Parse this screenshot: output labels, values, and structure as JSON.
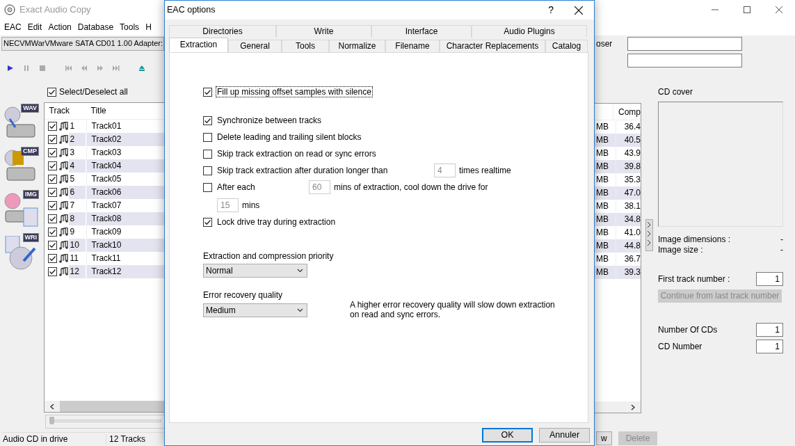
{
  "main_window": {
    "title": "Exact Audio Copy",
    "menu": [
      "EAC",
      "Edit",
      "Action",
      "Database",
      "Tools",
      "H"
    ],
    "drive": "NECVMWarVMware SATA CD01 1.00  Adapter:",
    "select_all": {
      "label": "Select/Deselect all",
      "checked": true
    },
    "actions": [
      {
        "label": "WAV",
        "kind": "wav"
      },
      {
        "label": "CMP",
        "kind": "cmp"
      },
      {
        "label": "IMG",
        "kind": "img"
      },
      {
        "label": "WRI",
        "kind": "wri"
      }
    ],
    "track_table": {
      "columns": [
        "Track",
        "Title"
      ],
      "rows": [
        {
          "checked": true,
          "number": "1",
          "title": "Track01"
        },
        {
          "checked": true,
          "number": "2",
          "title": "Track02"
        },
        {
          "checked": true,
          "number": "3",
          "title": "Track03"
        },
        {
          "checked": true,
          "number": "4",
          "title": "Track04"
        },
        {
          "checked": true,
          "number": "5",
          "title": "Track05"
        },
        {
          "checked": true,
          "number": "6",
          "title": "Track06"
        },
        {
          "checked": true,
          "number": "7",
          "title": "Track07"
        },
        {
          "checked": true,
          "number": "8",
          "title": "Track08"
        },
        {
          "checked": true,
          "number": "9",
          "title": "Track09"
        },
        {
          "checked": true,
          "number": "10",
          "title": "Track10"
        },
        {
          "checked": true,
          "number": "11",
          "title": "Track11"
        },
        {
          "checked": true,
          "number": "12",
          "title": "Track12"
        }
      ]
    },
    "composer_label": "oser",
    "size_table": {
      "columns": [
        "Comp"
      ],
      "rows": [
        {
          "size": "MB",
          "comp": "36.4"
        },
        {
          "size": "MB",
          "comp": "40.5"
        },
        {
          "size": "MB",
          "comp": "43.9"
        },
        {
          "size": "MB",
          "comp": "39.8"
        },
        {
          "size": "MB",
          "comp": "35.3"
        },
        {
          "size": "MB",
          "comp": "47.0"
        },
        {
          "size": "MB",
          "comp": "38.1"
        },
        {
          "size": "MB",
          "comp": "34.8"
        },
        {
          "size": "MB",
          "comp": "41.0"
        },
        {
          "size": "MB",
          "comp": "44.8"
        },
        {
          "size": "MB",
          "comp": "36.7"
        },
        {
          "size": "MB",
          "comp": "39.3"
        }
      ]
    },
    "cover": {
      "title": "CD cover",
      "details": [
        {
          "label": "Image dimensions :",
          "value": "-"
        },
        {
          "label": "Image size :",
          "value": "-"
        }
      ]
    },
    "first_track": {
      "label": "First track number :",
      "value": "1"
    },
    "continue_button": {
      "label": "Continue from last track number",
      "disabled": true
    },
    "cds": [
      {
        "label": "Number Of CDs",
        "value": "1"
      },
      {
        "label": "CD Number",
        "value": "1"
      }
    ],
    "buttons": [
      {
        "label": "w",
        "disabled": false
      },
      {
        "label": "Delete",
        "disabled": true
      }
    ],
    "position_slider": {
      "level": 0
    },
    "status_bar": [
      "Audio CD in drive",
      "12 Tracks"
    ]
  },
  "dialog": {
    "title": "EAC options",
    "help": "?",
    "tabs_back": [
      {
        "label": "Directories",
        "selected": false
      },
      {
        "label": "Write",
        "selected": false
      },
      {
        "label": "Interface",
        "selected": false
      },
      {
        "label": "Audio Plugins",
        "selected": false
      }
    ],
    "tabs_front": [
      {
        "label": "Extraction",
        "selected": true
      },
      {
        "label": "General",
        "selected": false
      },
      {
        "label": "Tools",
        "selected": false
      },
      {
        "label": "Normalize",
        "selected": false
      },
      {
        "label": "Filename",
        "selected": false
      },
      {
        "label": "Character Replacements",
        "selected": false
      },
      {
        "label": "Catalog",
        "selected": false
      }
    ],
    "options": [
      {
        "kind": "check",
        "label": "Fill up missing offset samples with silence",
        "checked": true,
        "focused": true
      },
      {
        "kind": "check",
        "label": "Synchronize between tracks",
        "checked": true,
        "focused": false
      },
      {
        "kind": "check",
        "label": "Delete leading and trailing silent blocks",
        "checked": false,
        "focused": false
      },
      {
        "kind": "check",
        "label": "Skip track extraction on read or sync errors",
        "checked": false,
        "focused": false
      },
      {
        "kind": "check_long_field",
        "label": "Skip track extraction after duration longer than",
        "checked": false,
        "focused": false,
        "value": "4",
        "disabled": true,
        "suffix": "times realtime"
      },
      {
        "kind": "check_field",
        "label": "After each",
        "checked": false,
        "focused": false,
        "value": "60",
        "disabled": true,
        "suffix": "mins of extraction, cool down the drive for"
      },
      {
        "kind": "field",
        "value": "15",
        "disabled": true,
        "suffix": "mins"
      },
      {
        "kind": "check",
        "label": "Lock drive tray during extraction",
        "checked": true,
        "focused": false
      }
    ],
    "selects": [
      {
        "label": "Extraction and compression priority",
        "value": "Normal"
      },
      {
        "label": "Error recovery quality",
        "value": "Medium",
        "note": "A higher error recovery quality will slow down extraction on read and sync errors."
      }
    ],
    "buttons": [
      {
        "label": "OK",
        "default": true
      },
      {
        "label": "Annuler",
        "default": false
      }
    ]
  }
}
